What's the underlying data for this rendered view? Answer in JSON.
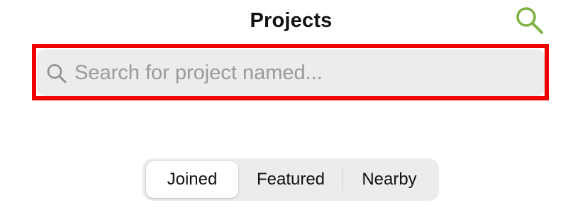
{
  "header": {
    "title": "Projects",
    "search_icon": "magnifying-glass-icon",
    "accent_color": "#7cb342"
  },
  "search": {
    "placeholder": "Search for project named...",
    "value": "",
    "icon": "magnifying-glass-icon",
    "highlight_color": "#ee0000"
  },
  "segmented_control": {
    "selected": "Joined",
    "segments": [
      {
        "label": "Joined"
      },
      {
        "label": "Featured"
      },
      {
        "label": "Nearby"
      }
    ]
  }
}
